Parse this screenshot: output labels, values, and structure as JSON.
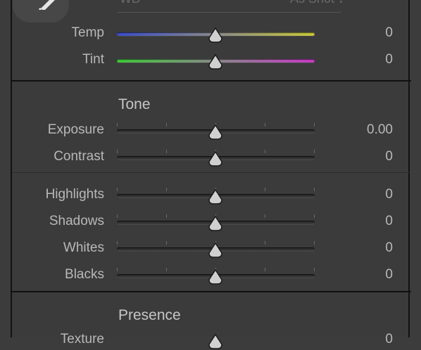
{
  "white_balance": {
    "ghost_left": "WB",
    "ghost_right": "As Shot ↕",
    "eyedropper_icon": "eyedropper-icon",
    "sliders": [
      {
        "label": "Temp",
        "value": "0",
        "position": 0.5,
        "track": "temp"
      },
      {
        "label": "Tint",
        "value": "0",
        "position": 0.5,
        "track": "tint"
      }
    ]
  },
  "tone": {
    "title": "Tone",
    "sliders": [
      {
        "label": "Exposure",
        "value": "0.00",
        "position": 0.5
      },
      {
        "label": "Contrast",
        "value": "0",
        "position": 0.5
      }
    ],
    "sliders2": [
      {
        "label": "Highlights",
        "value": "0",
        "position": 0.5
      },
      {
        "label": "Shadows",
        "value": "0",
        "position": 0.5
      },
      {
        "label": "Whites",
        "value": "0",
        "position": 0.5
      },
      {
        "label": "Blacks",
        "value": "0",
        "position": 0.5
      }
    ]
  },
  "presence": {
    "title": "Presence",
    "first_slider_label": "Texture",
    "first_slider_value": "0"
  },
  "colors": {
    "panel_bg": "#3b3b3b",
    "label": "#b8b8b8",
    "temp_left": "#3a4dc8",
    "temp_right": "#c8c83a",
    "tint_left": "#3ec83a",
    "tint_right": "#c83ac8"
  }
}
